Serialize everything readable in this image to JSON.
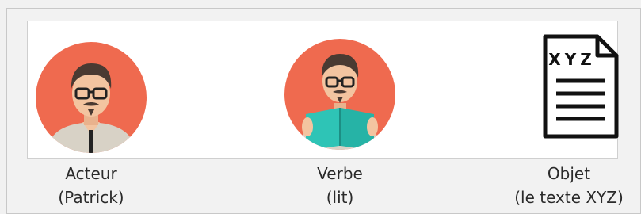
{
  "items": [
    {
      "role": "actor",
      "icon": "person-icon",
      "line1": "Acteur",
      "line2": "(Patrick)"
    },
    {
      "role": "verb",
      "icon": "person-reading-book-icon",
      "line1": "Verbe",
      "line2": "(lit)"
    },
    {
      "role": "object",
      "icon": "document-icon",
      "line1": "Objet",
      "line2": "(le texte XYZ)",
      "document_heading": "XYZ"
    }
  ],
  "colors": {
    "circle": "#ef6a4f",
    "book": "#2ec4b6",
    "skin": "#f3c4a0",
    "hair": "#4a3a32",
    "shirt": "#d8d2c6"
  }
}
